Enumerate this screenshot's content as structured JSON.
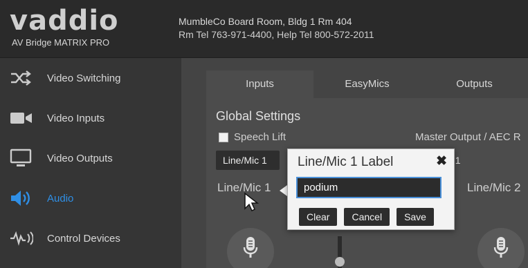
{
  "header": {
    "logo_word": "vaddio",
    "product": "AV Bridge MATRIX PRO",
    "room": "MumbleCo Board Room, Bldg 1 Rm 404",
    "phones": "Rm Tel 763-971-4400, Help Tel 800-572-2011"
  },
  "sidebar": {
    "items": [
      {
        "label": "Video Switching",
        "icon": "shuffle-icon"
      },
      {
        "label": "Video Inputs",
        "icon": "video-camera-icon"
      },
      {
        "label": "Video Outputs",
        "icon": "monitor-icon"
      },
      {
        "label": "Audio",
        "icon": "speaker-icon",
        "active": true
      },
      {
        "label": "Control Devices",
        "icon": "signal-icon"
      }
    ]
  },
  "tabs": [
    {
      "label": "Inputs",
      "active": true
    },
    {
      "label": "EasyMics"
    },
    {
      "label": "Outputs"
    }
  ],
  "panel": {
    "global_title": "Global Settings",
    "speech_lift": "Speech Lift",
    "speech_lift_checked": false,
    "master_label": "Master Output / AEC R",
    "selected_input": "Line/Mic 1",
    "input_partial": "t 1",
    "channel_left": "Line/Mic 1",
    "channel_right": "Line/Mic 2"
  },
  "popup": {
    "title": "Line/Mic 1 Label",
    "close_glyph": "✖",
    "input_value": "podium",
    "clear_label": "Clear",
    "cancel_label": "Cancel",
    "save_label": "Save"
  },
  "colors": {
    "accent": "#2f8fe6",
    "header_bg": "#2a2a2a",
    "sidebar_bg": "#353535",
    "popup_bg": "#f3f3f3"
  }
}
